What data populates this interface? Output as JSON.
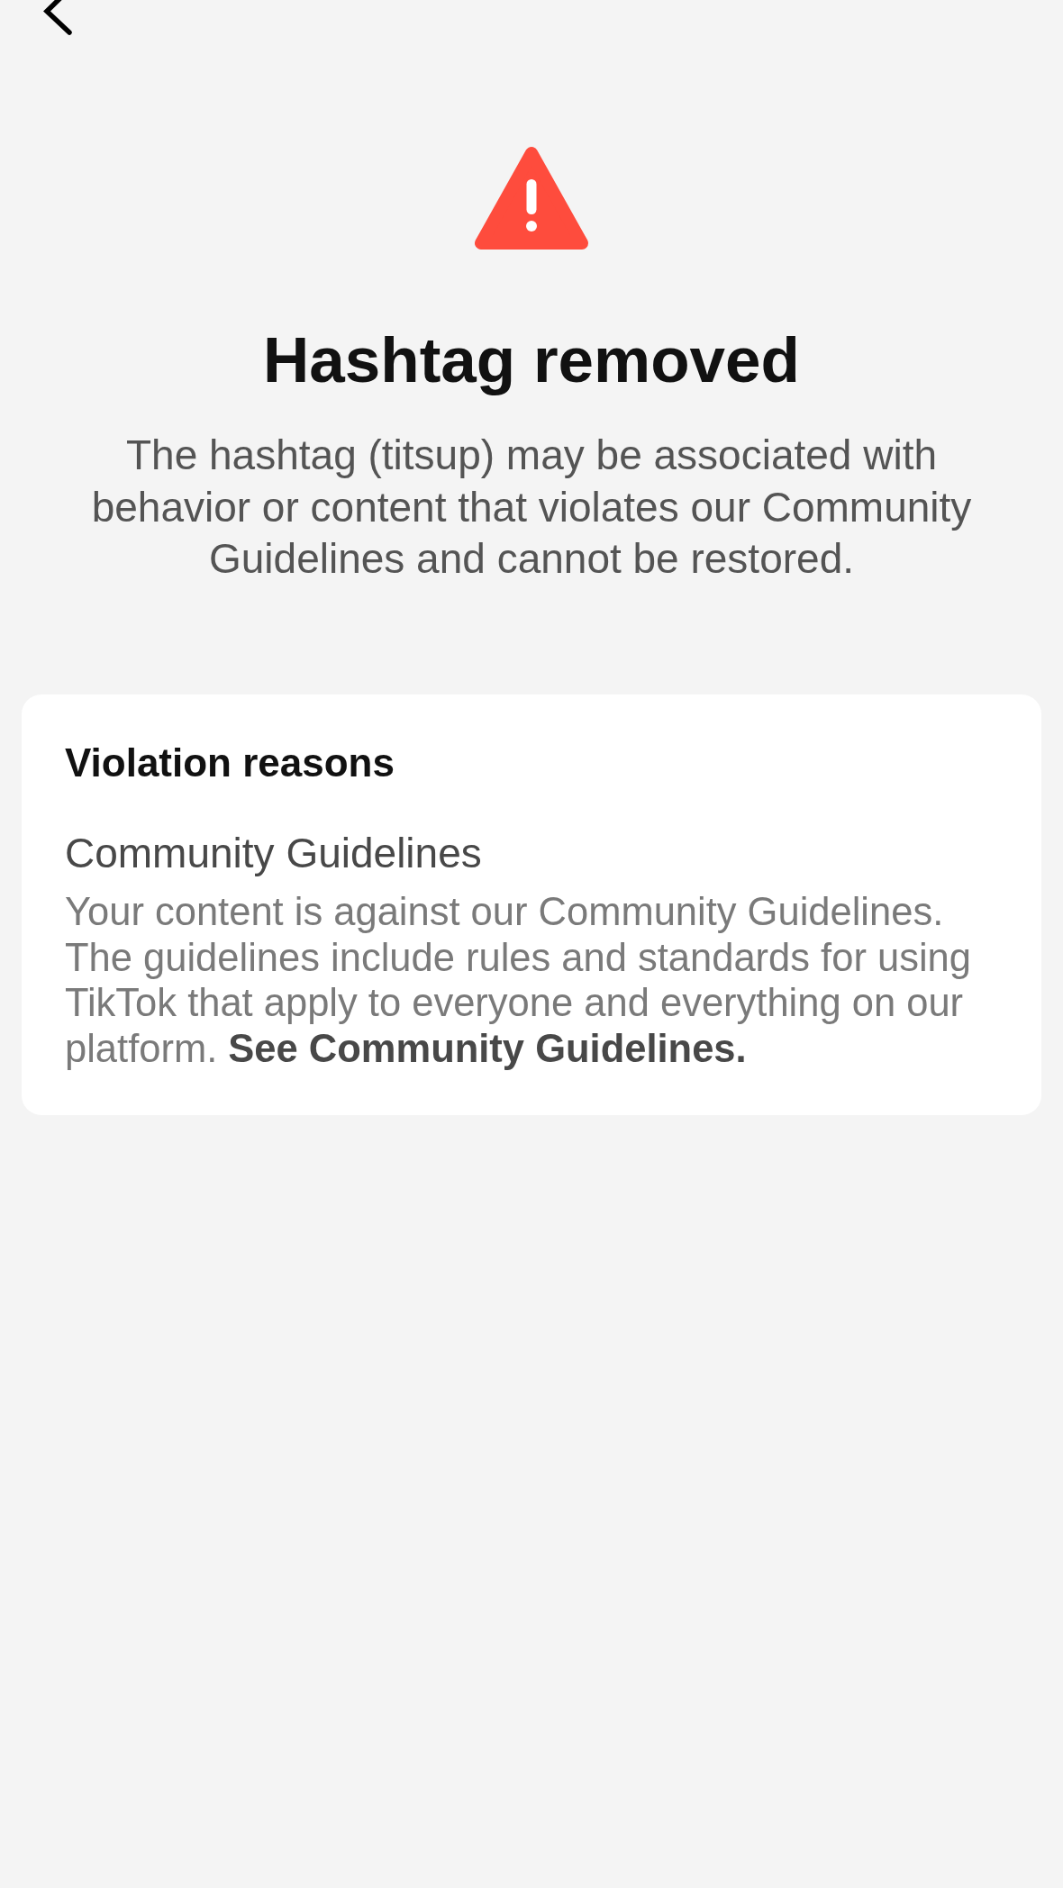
{
  "notice": {
    "title": "Hashtag removed",
    "description": "The hashtag (titsup) may be associated with behavior or content that violates our Community Guidelines and cannot be restored."
  },
  "violation_reasons": {
    "heading": "Violation reasons",
    "reasons": [
      {
        "title": "Community Guidelines",
        "description": "Your content is against our Community Guidelines. The guidelines include rules and standards for using TikTok that apply to everyone and everything on our platform.",
        "link": "See Community Guidelines."
      }
    ]
  }
}
